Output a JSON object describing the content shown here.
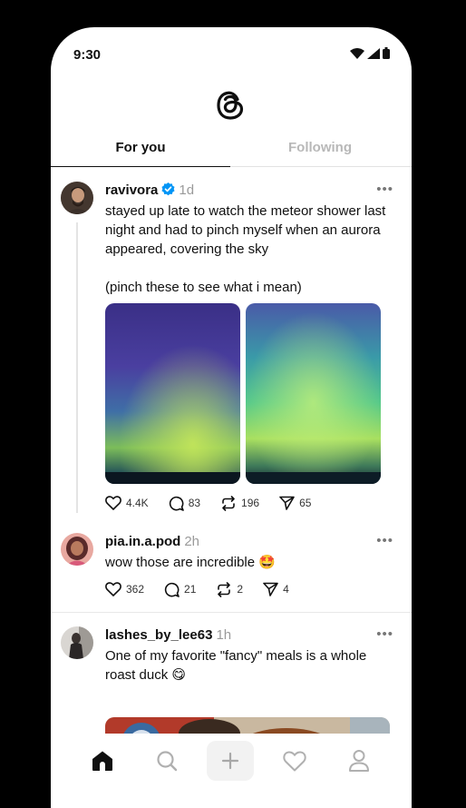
{
  "status": {
    "time": "9:30"
  },
  "tabs": {
    "for_you": "For you",
    "following": "Following",
    "active": "For you"
  },
  "posts": [
    {
      "username": "ravivora",
      "verified": true,
      "time": "1d",
      "text_line1": "stayed up late to watch the meteor shower last night and had to pinch myself when an aurora appeared, covering the sky",
      "text_line2": "(pinch these to see what i mean)",
      "images": [
        "aurora-photo-1",
        "aurora-photo-2"
      ],
      "likes": "4.4K",
      "replies": "83",
      "reposts": "196",
      "shares": "65"
    },
    {
      "username": "pia.in.a.pod",
      "time": "2h",
      "text": "wow those are incredible 🤩",
      "likes": "362",
      "replies": "21",
      "reposts": "2",
      "shares": "4"
    },
    {
      "username": "lashes_by_lee63",
      "time": "1h",
      "text": "One of my favorite \"fancy\" meals is a whole roast duck 😋",
      "images": [
        "roast-duck-photo"
      ]
    }
  ],
  "icons": {
    "logo": "threads-logo-icon",
    "more": "more-horizontal-icon",
    "like": "heart-icon",
    "reply": "comment-icon",
    "repost": "repost-icon",
    "share": "send-icon",
    "nav": [
      "home-icon",
      "search-icon",
      "plus-icon",
      "heart-icon",
      "profile-icon"
    ]
  },
  "colors": {
    "verified": "#0095f6",
    "muted": "#9a9a9a",
    "text": "#101010"
  }
}
